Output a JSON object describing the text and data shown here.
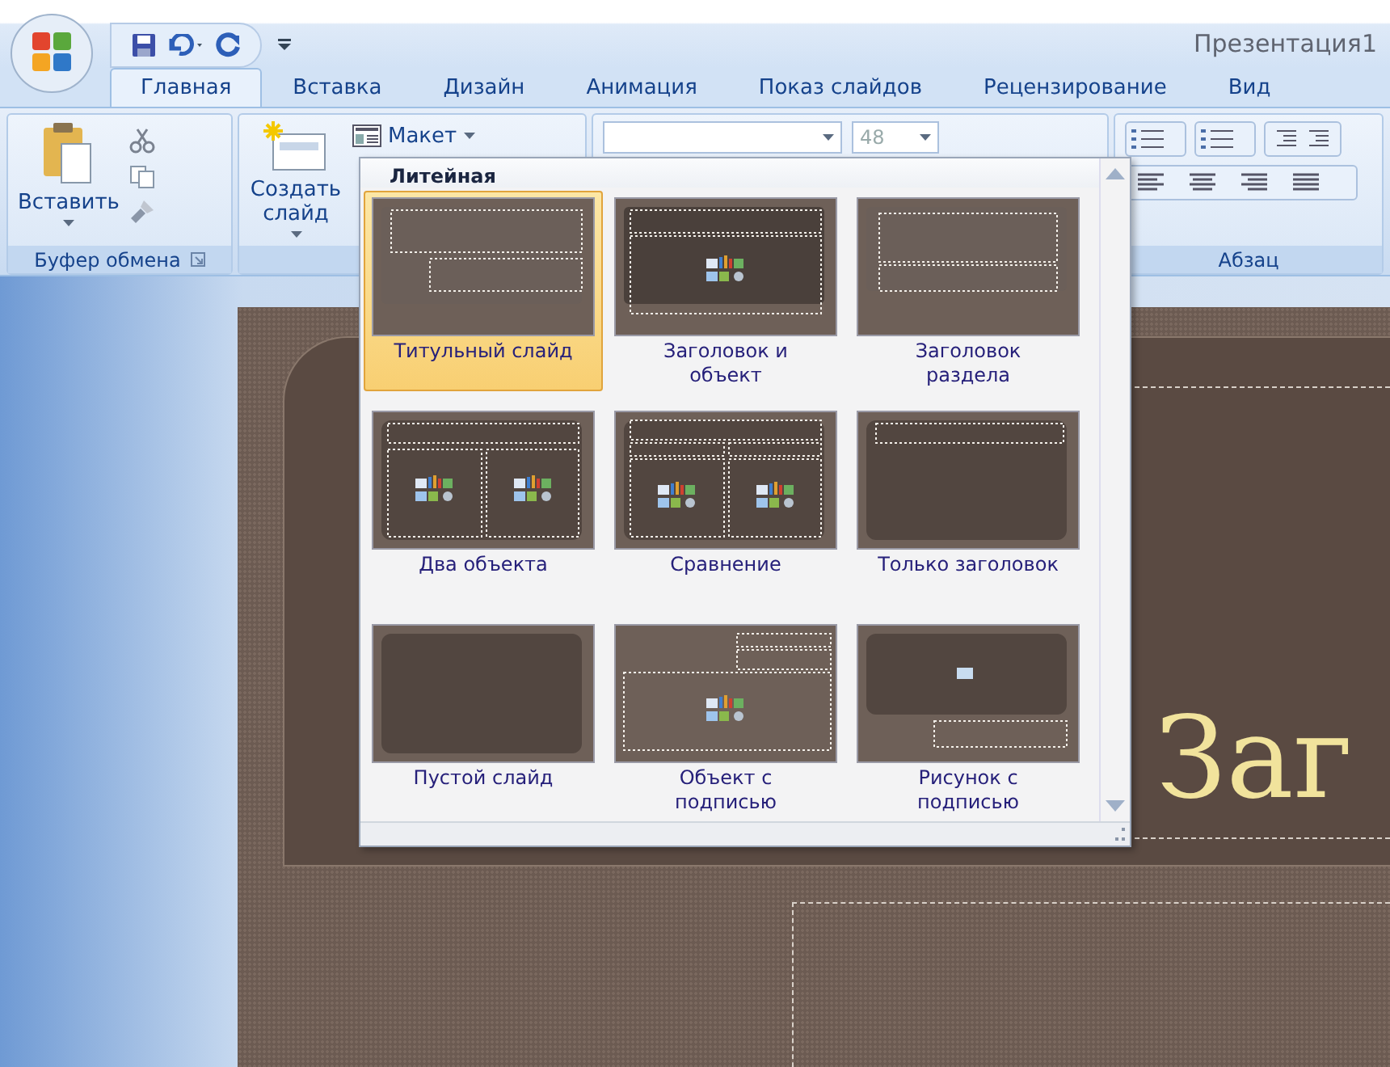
{
  "window": {
    "title": "Презентация1"
  },
  "tabs": [
    {
      "label": "Главная",
      "selected": true
    },
    {
      "label": "Вставка",
      "selected": false
    },
    {
      "label": "Дизайн",
      "selected": false
    },
    {
      "label": "Анимация",
      "selected": false
    },
    {
      "label": "Показ слайдов",
      "selected": false
    },
    {
      "label": "Рецензирование",
      "selected": false
    },
    {
      "label": "Вид",
      "selected": false
    }
  ],
  "ribbon": {
    "clipboard": {
      "paste_label": "Вставить",
      "group_label": "Буфер обмена"
    },
    "slides": {
      "new_slide_label": "Создать слайд",
      "layout_label": "Макет"
    },
    "font": {
      "size": "48"
    },
    "paragraph": {
      "group_label": "Абзац"
    }
  },
  "layout_gallery": {
    "theme": "Литейная",
    "layouts": [
      {
        "label": "Титульный слайд",
        "kind": "title",
        "selected": true
      },
      {
        "label": "Заголовок и объект",
        "kind": "title_content",
        "selected": false
      },
      {
        "label": "Заголовок раздела",
        "kind": "section",
        "selected": false
      },
      {
        "label": "Два объекта",
        "kind": "two_content",
        "selected": false
      },
      {
        "label": "Сравнение",
        "kind": "comparison",
        "selected": false
      },
      {
        "label": "Только заголовок",
        "kind": "title_only",
        "selected": false
      },
      {
        "label": "Пустой слайд",
        "kind": "blank",
        "selected": false
      },
      {
        "label": "Объект с подписью",
        "kind": "content_caption",
        "selected": false
      },
      {
        "label": "Рисунок с подписью",
        "kind": "picture_caption",
        "selected": false
      }
    ]
  },
  "slide": {
    "title_text": "Заг"
  }
}
